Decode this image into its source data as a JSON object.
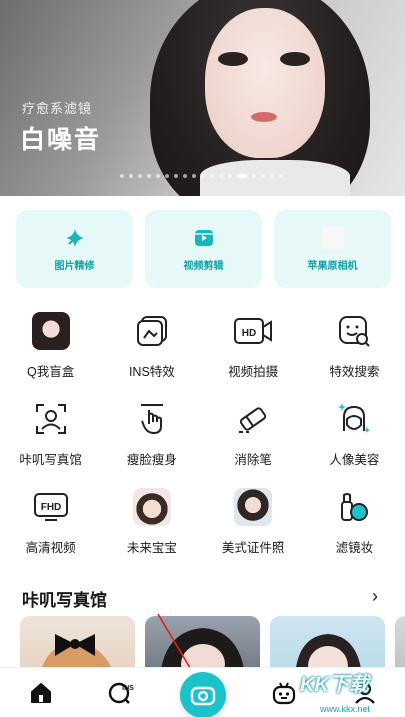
{
  "banner": {
    "subtitle": "疗愈系滤镜",
    "title": "白噪音",
    "dot_count": 18,
    "active_dot": 13
  },
  "feature_cards": [
    {
      "label": "图片精修",
      "icon": "sparkle-icon"
    },
    {
      "label": "视频剪辑",
      "icon": "video-edit-icon"
    },
    {
      "label": "苹果原相机",
      "icon": "apple-camera-icon"
    }
  ],
  "tools": [
    {
      "label": "Q我盲盒",
      "icon": "avatar-girl-1"
    },
    {
      "label": "INS特效",
      "icon": "ins-effect-icon"
    },
    {
      "label": "视频拍摄",
      "icon": "hd-video-icon"
    },
    {
      "label": "特效搜索",
      "icon": "effect-search-icon"
    },
    {
      "label": "咔叽写真馆",
      "icon": "portrait-frame-icon"
    },
    {
      "label": "瘦脸瘦身",
      "icon": "slim-hand-icon"
    },
    {
      "label": "消除笔",
      "icon": "eraser-icon"
    },
    {
      "label": "人像美容",
      "icon": "beauty-face-icon"
    },
    {
      "label": "高清视频",
      "icon": "fhd-icon"
    },
    {
      "label": "未来宝宝",
      "icon": "avatar-baby"
    },
    {
      "label": "美式证件照",
      "icon": "avatar-id-photo"
    },
    {
      "label": "滤镜妆",
      "icon": "makeup-filter-icon"
    }
  ],
  "section": {
    "title": "咔叽写真馆",
    "arrow": "›"
  },
  "watermark": {
    "text": "KK下载",
    "url": "www.kkx.net"
  },
  "colors": {
    "accent": "#19c3c9",
    "card_bg": "#e6f8f8",
    "card_text": "#0fa3a3"
  },
  "nav": [
    "home-icon",
    "ins-search-icon",
    "camera-icon",
    "robot-icon",
    "profile-icon"
  ]
}
